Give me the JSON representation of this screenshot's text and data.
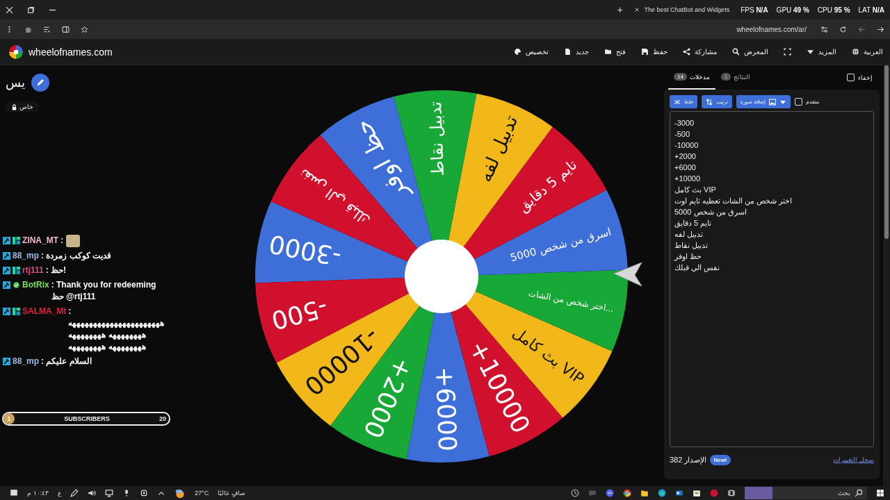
{
  "browser": {
    "tab_title": "The best ChatBot and Widgets",
    "new_tab": "+",
    "address": "wheelofnames.com/ar/"
  },
  "perf_overlay": [
    "LAT **N/A**",
    "CPU **95 %**",
    "GPU **49 %**",
    "FPS **N/A**"
  ],
  "site": {
    "logo_text": "wheelofnames.com",
    "nav_more": [
      "العربية",
      "المزيد"
    ],
    "nav": [
      "المعرض",
      "مشاركة",
      "حفظ",
      "فتح",
      "جديد",
      "تخصيص"
    ]
  },
  "wheel_info": {
    "title": "يس",
    "visibility": "خاص"
  },
  "chat": [
    {
      "user": "ZINA_MT",
      "color": "#f2b8c6",
      "text": ":",
      "subscriber": true,
      "verified": false,
      "emote": true
    },
    {
      "user": "88_mp",
      "color": "#9db8e0",
      "text": ": قديت كوكب زمردة",
      "subscriber": false,
      "verified": false,
      "emote": false
    },
    {
      "user": "rtj111",
      "color": "#d9507a",
      "text": ": حظ!",
      "subscriber": true,
      "verified": false,
      "emote": false
    },
    {
      "user": "BotRix",
      "color": "#7ae05a",
      "text": ": Thank you for redeeming حظ @rtj111",
      "subscriber": false,
      "verified": true,
      "emote": false
    },
    {
      "user": "SALMA_Mt",
      "color": "#e0203a",
      "text": ": ههههههههههههههههههههههه ههههههههه ههههههههه ههههههههه ههههههههه",
      "subscriber": true,
      "verified": false,
      "emote": false
    },
    {
      "user": "88_mp",
      "color": "#9db8e0",
      "text": ": السلام عليكم",
      "subscriber": false,
      "verified": false,
      "emote": false
    }
  ],
  "subscribers": {
    "count": "1",
    "label": "SUBSCRIBERS",
    "goal": "20",
    "level": 0.05
  },
  "wheel": {
    "segments": [
      {
        "label": "-3000",
        "color": "#3e6fd8"
      },
      {
        "label": "-500",
        "color": "#d0102c"
      },
      {
        "label": "-10000",
        "color": "#f2b718"
      },
      {
        "label": "+2000",
        "color": "#18a838"
      },
      {
        "label": "+6000",
        "color": "#3e6fd8"
      },
      {
        "label": "+10000",
        "color": "#d0102c"
      },
      {
        "label": "بث كامل VIP",
        "color": "#f2b718"
      },
      {
        "label": "اختر شخص من الشات...",
        "color": "#18a838"
      },
      {
        "label": "اسرق من شخص 5000",
        "color": "#3e6fd8"
      },
      {
        "label": "تايم 5 دقايق",
        "color": "#d0102c"
      },
      {
        "label": "تدبيل لفه",
        "color": "#f2b718"
      },
      {
        "label": "تدبيل نقاط",
        "color": "#18a838"
      },
      {
        "label": "حظ اوفر",
        "color": "#3e6fd8"
      },
      {
        "label": "نفس الي قبلك",
        "color": "#d0102c"
      }
    ]
  },
  "entries_panel": {
    "tabs": [
      {
        "label": "النتائج",
        "count": "1",
        "selected": false
      },
      {
        "label": "مدخلات",
        "count": "14",
        "selected": true
      }
    ],
    "hide": {
      "label": "إخفاء",
      "checked": false
    },
    "buttons": [
      "إضافة صورة",
      "ترتيب",
      "خلط"
    ],
    "advanced": {
      "label": "متقدم",
      "checked": false
    },
    "entries": [
      "-3000",
      "-500",
      "-10000",
      "+2000",
      "+6000",
      "+10000",
      "بث كامل VIP",
      "اختر شخص من الشات تعطيه تايم اوت",
      "اسرق من شخص 5000",
      "تايم 5 دقايق",
      "تدبيل لفه",
      "تدبيل نقاط",
      "حظ اوفر",
      "نفس الي قبلك"
    ],
    "version": "الإصدار 382",
    "new_badge": "New!",
    "changelog": "سجل التغييرات"
  },
  "taskbar": {
    "time": "١٠:٤٣ م",
    "language": "ع",
    "temperature": "27°C",
    "weather_text": "صافٍ غالبًا",
    "search": "بحث"
  }
}
